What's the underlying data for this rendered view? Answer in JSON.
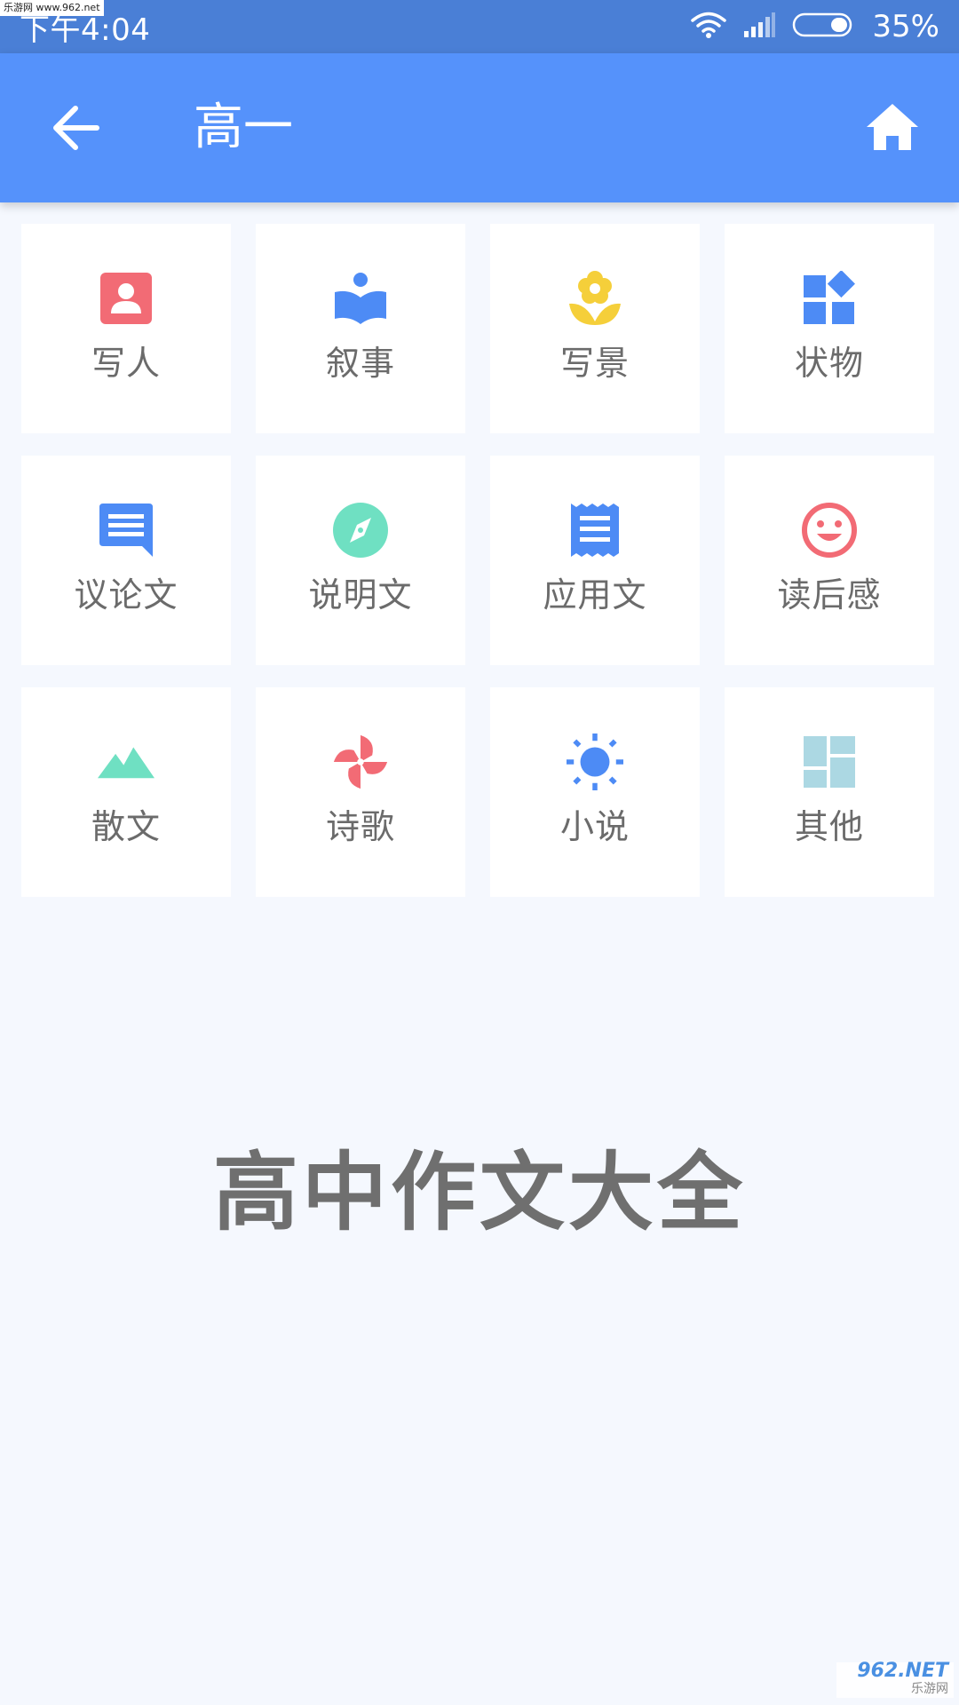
{
  "status_bar": {
    "time": "下午4:04",
    "battery": "35%"
  },
  "watermark_top": "乐游网 www.962.net",
  "app_bar": {
    "title": "高一"
  },
  "categories": [
    {
      "label": "写人",
      "icon": "person-card-icon",
      "color": "#f26b75"
    },
    {
      "label": "叙事",
      "icon": "reading-book-icon",
      "color": "#4d8bf5"
    },
    {
      "label": "写景",
      "icon": "flower-icon",
      "color": "#f5cf3a"
    },
    {
      "label": "状物",
      "icon": "shapes-icon",
      "color": "#4d8bf5"
    },
    {
      "label": "议论文",
      "icon": "comment-icon",
      "color": "#4d8bf5"
    },
    {
      "label": "说明文",
      "icon": "compass-icon",
      "color": "#6fe0c2"
    },
    {
      "label": "应用文",
      "icon": "receipt-icon",
      "color": "#4d8bf5"
    },
    {
      "label": "读后感",
      "icon": "smiley-icon",
      "color": "#f26b75"
    },
    {
      "label": "散文",
      "icon": "mountain-icon",
      "color": "#6fe0c2"
    },
    {
      "label": "诗歌",
      "icon": "pinwheel-icon",
      "color": "#f26b75"
    },
    {
      "label": "小说",
      "icon": "sun-icon",
      "color": "#4d8bf5"
    },
    {
      "label": "其他",
      "icon": "dashboard-icon",
      "color": "#acd8e3"
    }
  ],
  "footer": {
    "title": "高中作文大全"
  },
  "watermark_bottom": {
    "main": "962.NET",
    "sub": "乐游网"
  }
}
